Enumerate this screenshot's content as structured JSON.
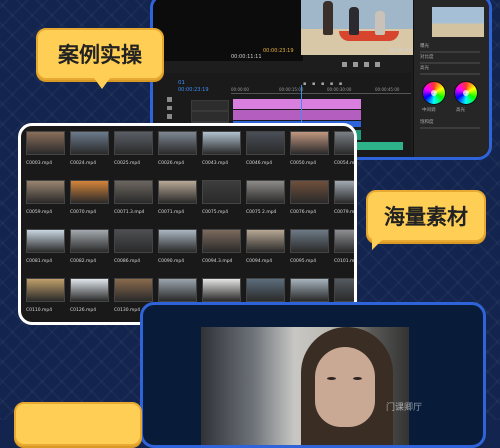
{
  "callouts": {
    "case_practice": "案例实操",
    "massive_materials": "海量素材"
  },
  "watermark": "门课卿厅",
  "editor": {
    "source_timecode": "00:00:11:11",
    "program_timecode": "00:00:23:19",
    "program_duration": "00:00:47:01",
    "sequence_name": "01",
    "timeline_timecode": "00:00:23:19",
    "ruler_marks": [
      "00:00:00",
      "00:00:15:00",
      "00:00:30:00",
      "00:00:45:00"
    ],
    "clip_label": "剪辑素材",
    "panel_labels": [
      "曝光",
      "对比度",
      "高光",
      "阴影",
      "白色",
      "黑色",
      "饱和度"
    ],
    "wheel_labels": [
      "中间调",
      "高光"
    ]
  },
  "media": {
    "rows": [
      [
        "C0003.mp4",
        "C0024.mp4",
        "C0025.mp4",
        "C0026.mp4",
        "C0043.mp4",
        "C0046.mp4",
        "C0050.mp4",
        "C0054.mp4"
      ],
      [
        "C0059.mp4",
        "C0070.mp4",
        "C0071.3.mp4",
        "C0071.mp4",
        "C0075.mp4",
        "C0075 2.mp4",
        "C0076.mp4",
        "C0079.mp4"
      ],
      [
        "C0081.mp4",
        "C0082.mp4",
        "C0086.mp4",
        "C0090.mp4",
        "C0094.3.mp4",
        "C0094.mp4",
        "C0095.mp4",
        "C0101.mp4"
      ],
      [
        "C0110.mp4",
        "C0126.mp4",
        "C0130.mp4",
        "C0141.mp4",
        "C0146.mp4",
        "C0147.mp4",
        "C0155.mp4",
        "C0163.mp4"
      ]
    ],
    "thumb_colors": [
      [
        "#8a6e5a",
        "#6b7a8c",
        "#5a5f66",
        "#7d8792",
        "#b0c2cf",
        "#4a4f57",
        "#c09880",
        "#7a7f86"
      ],
      [
        "#9a8570",
        "#d4843a",
        "#6c6660",
        "#b7a896",
        "#3d3d3d",
        "#8e8c89",
        "#6f4f3b",
        "#a2aab2"
      ],
      [
        "#c9d6e2",
        "#a3a9ae",
        "#4d4f52",
        "#aab6c1",
        "#7c6a5d",
        "#b8a894",
        "#6d7a86",
        "#8d8f92"
      ],
      [
        "#c0a06a",
        "#dfe6ec",
        "#8a6a4d",
        "#9aa4ad",
        "#e4e4e2",
        "#5c6d7c",
        "#a7b3bd",
        "#545a60"
      ]
    ]
  }
}
